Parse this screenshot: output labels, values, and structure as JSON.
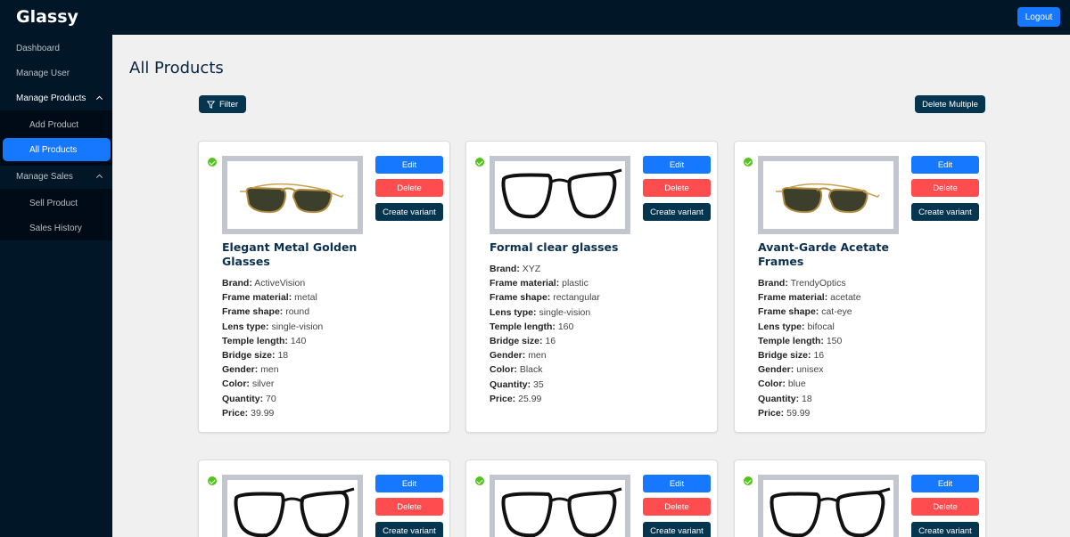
{
  "app": {
    "brand": "Glassy",
    "logout_label": "Logout"
  },
  "sidebar": {
    "dashboard": "Dashboard",
    "manage_user": "Manage User",
    "manage_products": {
      "label": "Manage Products",
      "children": [
        "Add Product",
        "All Products"
      ]
    },
    "manage_sales": {
      "label": "Manage Sales",
      "children": [
        "Sell Product",
        "Sales History"
      ]
    },
    "active_item": "All Products"
  },
  "main": {
    "title": "All Products",
    "filter_label": "Filter",
    "delete_multiple_label": "Delete Multiple",
    "card_buttons": {
      "edit": "Edit",
      "delete": "Delete",
      "create_variant": "Create variant"
    },
    "attr_labels": {
      "brand": "Brand:",
      "frame_material": "Frame material:",
      "frame_shape": "Frame shape:",
      "lens_type": "Lens type:",
      "temple_length": "Temple length:",
      "bridge_size": "Bridge size:",
      "gender": "Gender:",
      "color": "Color:",
      "quantity": "Quantity:",
      "price": "Price:"
    },
    "products": [
      {
        "name": "Elegant Metal Golden Glasses",
        "image_icon": "golden-sunglasses",
        "brand": "ActiveVision",
        "frame_material": "metal",
        "frame_shape": "round",
        "lens_type": "single-vision",
        "temple_length": "140",
        "bridge_size": "18",
        "gender": "men",
        "color": "silver",
        "quantity": "70",
        "price": "39.99"
      },
      {
        "name": "Formal clear glasses",
        "image_icon": "black-eyeglasses",
        "brand": "XYZ",
        "frame_material": "plastic",
        "frame_shape": "rectangular",
        "lens_type": "single-vision",
        "temple_length": "160",
        "bridge_size": "16",
        "gender": "men",
        "color": "Black",
        "quantity": "35",
        "price": "25.99"
      },
      {
        "name": "Avant-Garde Acetate Frames",
        "image_icon": "golden-sunglasses",
        "brand": "TrendyOptics",
        "frame_material": "acetate",
        "frame_shape": "cat-eye",
        "lens_type": "bifocal",
        "temple_length": "150",
        "bridge_size": "16",
        "gender": "unisex",
        "color": "blue",
        "quantity": "18",
        "price": "59.99"
      },
      {
        "image_icon": "black-eyeglasses"
      },
      {
        "image_icon": "black-eyeglasses"
      },
      {
        "image_icon": "black-eyeglasses"
      }
    ]
  },
  "colors": {
    "nav_bg": "#011627",
    "primary": "#1677ff",
    "danger": "#ff4d4f",
    "dark_button": "#06354f",
    "success": "#52c41a"
  }
}
